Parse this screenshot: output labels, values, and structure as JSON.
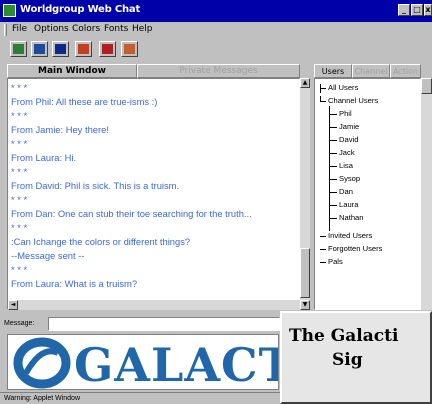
{
  "window": {
    "title": "Worldgroup Web Chat"
  },
  "menu": [
    "File",
    "Options",
    "Colors",
    "Fonts",
    "Help"
  ],
  "toolbar": {
    "buttons": [
      {
        "icon": "users-icon",
        "color": "#2e7d32"
      },
      {
        "icon": "list-icon",
        "color": "#1e4c9a"
      },
      {
        "icon": "monitor-icon",
        "color": "#0a2a8a"
      },
      {
        "icon": "pencil-icon",
        "color": "#c04020"
      },
      {
        "icon": "people-icon",
        "color": "#b02020"
      },
      {
        "icon": "document-icon",
        "color": "#c06030"
      }
    ]
  },
  "tabs": {
    "main": [
      "Main Window",
      "Private Messages"
    ],
    "side": [
      "Users",
      "Channel",
      "Action"
    ]
  },
  "chat_lines": [
    "* * *",
    "From Phil: All these are true-isms :)",
    "* * *",
    "From Jamie: Hey there!",
    "* * *",
    "From Laura: Hi.",
    "* * *",
    "From David: Phil is sick. This is a truism.",
    "* * *",
    "From Dan: One can stub their toe searching for the truth...",
    "* * *",
    ":Can Ichange the colors or different things?",
    "--Message sent --",
    "* * *",
    "From Laura: What is a truism?"
  ],
  "users_tree": {
    "all": "All Users",
    "channel": "Channel Users",
    "channel_members": [
      "Phil",
      "Jamie",
      "David",
      "Jack",
      "Lisa",
      "Sysop",
      "Dan",
      "Laura",
      "Nathan"
    ],
    "others": [
      "Invited Users",
      "Forgotten Users",
      "Pals"
    ]
  },
  "message": {
    "label": "Message:",
    "value": ""
  },
  "logo": {
    "text": "GALACTI",
    "color": "#1f67a8"
  },
  "overlay": {
    "line1": "The Galacti",
    "line2": "Sig"
  },
  "status": "Warning: Applet Window",
  "colors": {
    "titlebar": "#0000a8",
    "chat_text": "#3a6ad8",
    "chrome": "#c0c0c0"
  }
}
